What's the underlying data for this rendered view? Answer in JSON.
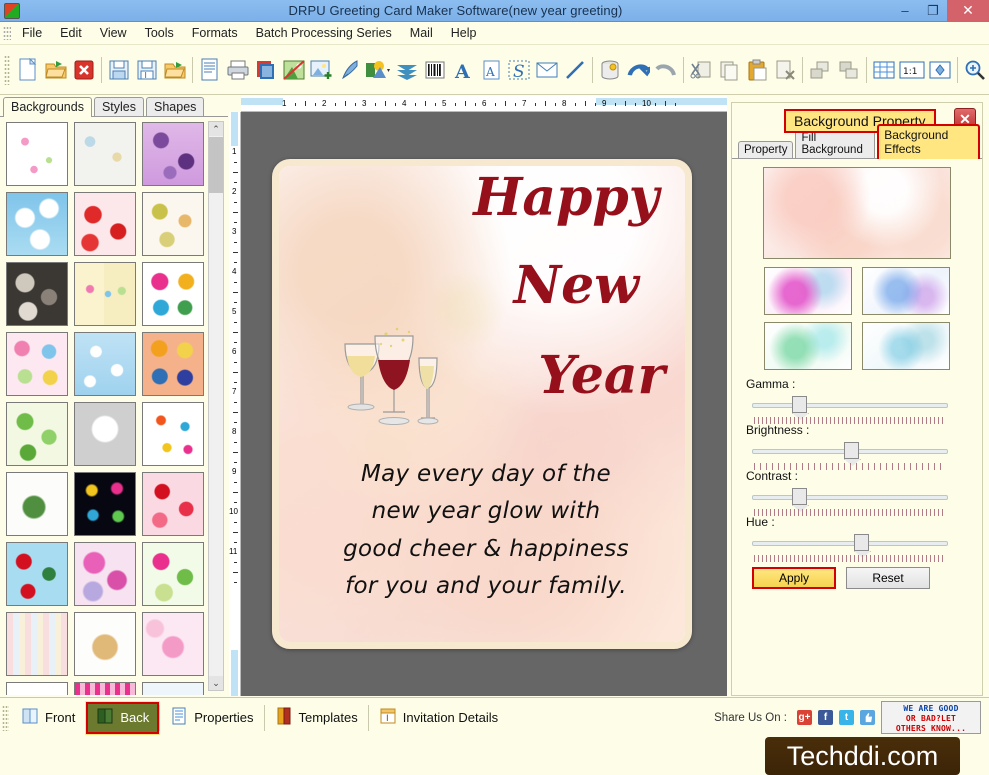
{
  "window": {
    "title": "DRPU Greeting Card Maker Software(new year greeting)",
    "minimize": "–",
    "restore": "❐",
    "close": "✕",
    "titlebar_color": "#7cb0e8",
    "close_color": "#d3626a"
  },
  "menu": {
    "items": [
      "File",
      "Edit",
      "View",
      "Tools",
      "Formats",
      "Batch Processing Series",
      "Mail",
      "Help"
    ]
  },
  "toolbar": {
    "icons": [
      {
        "name": "new-document-icon",
        "title": "New"
      },
      {
        "name": "open-folder-icon",
        "title": "Open"
      },
      {
        "name": "close-document-icon",
        "title": "Close"
      },
      {
        "name": "save-icon",
        "title": "Save"
      },
      {
        "name": "save-as-icon",
        "title": "Save As"
      },
      {
        "name": "open-template-icon",
        "title": "Open Template"
      },
      {
        "name": "page-setup-icon",
        "title": "Page Setup"
      },
      {
        "name": "print-icon",
        "title": "Print"
      },
      {
        "name": "batch-series-icon",
        "title": "Batch Series"
      },
      {
        "name": "image-icon",
        "title": "Image"
      },
      {
        "name": "add-image-icon",
        "title": "Add Image"
      },
      {
        "name": "pen-icon",
        "title": "Pen"
      },
      {
        "name": "shape-icon",
        "title": "Shapes"
      },
      {
        "name": "watermark-icon",
        "title": "Watermark"
      },
      {
        "name": "barcode-icon",
        "title": "Barcode"
      },
      {
        "name": "font-icon",
        "title": "Font"
      },
      {
        "name": "text-icon",
        "title": "Text"
      },
      {
        "name": "signature-icon",
        "title": "Signature"
      },
      {
        "name": "email-icon",
        "title": "Email"
      },
      {
        "name": "line-icon",
        "title": "Line"
      },
      {
        "name": "database-icon",
        "title": "Database"
      },
      {
        "name": "undo-icon",
        "title": "Undo"
      },
      {
        "name": "redo-icon",
        "title": "Redo"
      },
      {
        "name": "cut-icon",
        "title": "Cut"
      },
      {
        "name": "copy-icon",
        "title": "Copy"
      },
      {
        "name": "paste-icon",
        "title": "Paste"
      },
      {
        "name": "delete-icon",
        "title": "Delete"
      },
      {
        "name": "bring-front-icon",
        "title": "Bring to Front"
      },
      {
        "name": "send-back-icon",
        "title": "Send to Back"
      },
      {
        "name": "grid-icon",
        "title": "Grid"
      },
      {
        "name": "actual-size-icon",
        "title": "1:1"
      },
      {
        "name": "fit-screen-icon",
        "title": "Fit to Screen"
      },
      {
        "name": "zoom-in-icon",
        "title": "Zoom In"
      }
    ],
    "actual_size_label": "1:1"
  },
  "left_panel": {
    "tabs": [
      {
        "label": "Backgrounds",
        "active": true
      },
      {
        "label": "Styles",
        "active": false
      },
      {
        "label": "Shapes",
        "active": false
      }
    ],
    "scroll_up": "⌃",
    "scroll_down": "⌄",
    "thumbnails": [
      {
        "name": "baby-shower-pink"
      },
      {
        "name": "baby-blue-items"
      },
      {
        "name": "purple-flowers"
      },
      {
        "name": "blue-sky-clouds"
      },
      {
        "name": "strawberries"
      },
      {
        "name": "pastel-eggs"
      },
      {
        "name": "pebbles-stones"
      },
      {
        "name": "yellow-hanging-beads"
      },
      {
        "name": "gift-boxes"
      },
      {
        "name": "colorful-circles"
      },
      {
        "name": "blue-snowflakes"
      },
      {
        "name": "orange-mandalas"
      },
      {
        "name": "green-pine-trees"
      },
      {
        "name": "white-rose-heart"
      },
      {
        "name": "kids-toys-confetti"
      },
      {
        "name": "green-pinecones"
      },
      {
        "name": "fireworks-night"
      },
      {
        "name": "red-pink-hearts"
      },
      {
        "name": "christmas-santa"
      },
      {
        "name": "pink-pompoms"
      },
      {
        "name": "green-pink-leaves"
      },
      {
        "name": "pastel-stripes"
      },
      {
        "name": "teddy-bear"
      },
      {
        "name": "pink-princess"
      },
      {
        "name": "floral-row-1"
      },
      {
        "name": "pink-stripe-row"
      },
      {
        "name": "blue-pattern-row"
      }
    ]
  },
  "canvas": {
    "ruler_h_numbers": [
      "1",
      "2",
      "3",
      "4",
      "5",
      "6",
      "7",
      "8",
      "9",
      "10"
    ],
    "ruler_v_numbers": [
      "1",
      "2",
      "3",
      "4",
      "5",
      "6",
      "7",
      "8",
      "9",
      "10",
      "11"
    ],
    "card": {
      "title_lines": [
        "Happy",
        "New",
        "Year"
      ],
      "title_color": "#96101b",
      "message_lines": [
        "May every day of the",
        "new year glow with",
        "good cheer & happiness",
        "for you and your family."
      ],
      "art": "three-wine-glasses"
    }
  },
  "right_panel": {
    "title": "Background Property",
    "close": "✕",
    "tabs": [
      {
        "label": "Property",
        "active": false
      },
      {
        "label": "Fill Background",
        "active": false
      },
      {
        "label": "Background Effects",
        "active": true
      }
    ],
    "preview_name": "pink-floral-preview",
    "effect_previews": [
      {
        "name": "effect-magenta"
      },
      {
        "name": "effect-blue"
      },
      {
        "name": "effect-green"
      },
      {
        "name": "effect-cyan"
      }
    ],
    "sliders": [
      {
        "label": "Gamma :",
        "pos_pct": 22
      },
      {
        "label": "Brightness :",
        "pos_pct": 50
      },
      {
        "label": "Contrast :",
        "pos_pct": 22
      },
      {
        "label": "Hue :",
        "pos_pct": 55
      }
    ],
    "apply_label": "Apply",
    "reset_label": "Reset",
    "accent_color": "#ffe680",
    "highlight_border": "#d40000"
  },
  "bottom_bar": {
    "buttons": [
      {
        "label": "Front",
        "icon": "card-front-icon",
        "active": false
      },
      {
        "label": "Back",
        "icon": "card-back-icon",
        "active": true
      },
      {
        "label": "Properties",
        "icon": "properties-icon",
        "active": false
      },
      {
        "label": "Templates",
        "icon": "templates-icon",
        "active": false
      },
      {
        "label": "Invitation Details",
        "icon": "invitation-details-icon",
        "active": false
      }
    ],
    "share_label": "Share Us On :",
    "share_icons": [
      {
        "name": "google-plus-icon",
        "glyph": "g+",
        "color": "#d94235"
      },
      {
        "name": "facebook-icon",
        "glyph": "f",
        "color": "#3b5998"
      },
      {
        "name": "twitter-icon",
        "glyph": "t",
        "color": "#38b4e8"
      },
      {
        "name": "thumbs-up-icon",
        "glyph": "\u0001",
        "color": "#5aa7e0"
      }
    ],
    "feedback": {
      "line1": "WE ARE GOOD",
      "line2": "OR BAD?LET",
      "line3": "OTHERS KNOW..."
    }
  },
  "watermark": {
    "text": "Techddi.com"
  }
}
